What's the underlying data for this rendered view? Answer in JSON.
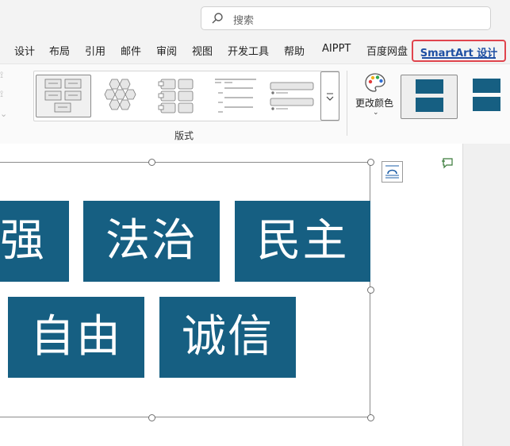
{
  "search": {
    "placeholder": "搜索"
  },
  "tabs": [
    {
      "label": "设计"
    },
    {
      "label": "布局"
    },
    {
      "label": "引用"
    },
    {
      "label": "邮件"
    },
    {
      "label": "审阅"
    },
    {
      "label": "视图"
    },
    {
      "label": "开发工具"
    },
    {
      "label": "帮助"
    },
    {
      "label": "AIPPT"
    },
    {
      "label": "百度网盘"
    },
    {
      "label": "SmartArt 设计",
      "active": true
    }
  ],
  "ribbon": {
    "layouts_group_label": "版式",
    "change_colors_label": "更改颜色",
    "selected_layout_index": 0,
    "selected_style_index": 0,
    "colors": {
      "accent": "#165f82",
      "active_tab": "#1e4fa3",
      "highlight_border": "#e0444d"
    }
  },
  "smartart": {
    "nodes": [
      {
        "text": "强"
      },
      {
        "text": "法治"
      },
      {
        "text": "民主"
      },
      {
        "text": "自由"
      },
      {
        "text": "诚信"
      }
    ],
    "node_color": "#165f82"
  },
  "icons": {
    "search": "search-icon",
    "more": "chevron-down-icon",
    "palette": "palette-icon",
    "layout_options": "layout-options-icon",
    "comment": "comment-icon"
  }
}
